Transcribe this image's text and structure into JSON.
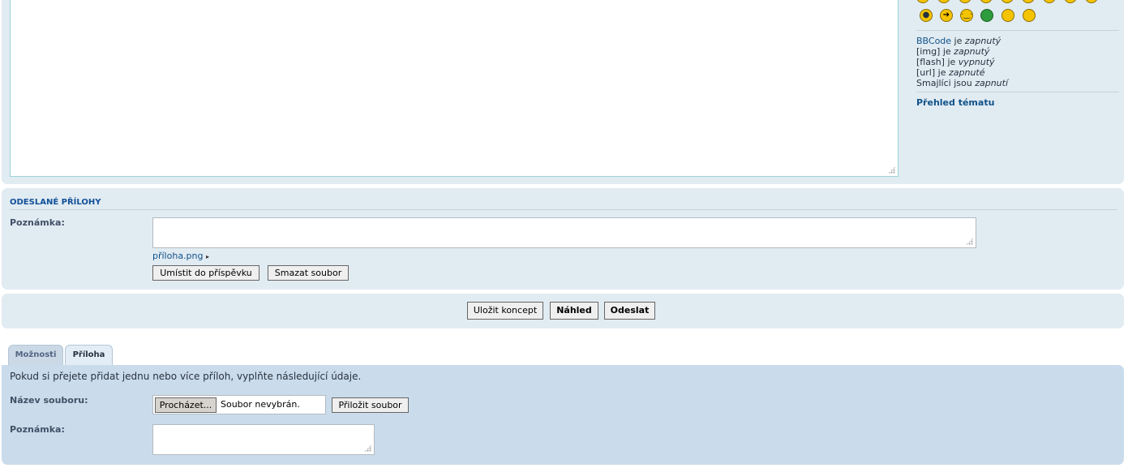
{
  "sidebar": {
    "status": [
      {
        "prefix_link": "BBCode",
        "mid": " je ",
        "state": "zapnutý"
      },
      {
        "prefix": "[img]",
        "mid": " je ",
        "state": "zapnutý"
      },
      {
        "prefix": "[flash]",
        "mid": " je ",
        "state": "vypnutý"
      },
      {
        "prefix": "[url]",
        "mid": " je ",
        "state": "zapnuté"
      },
      {
        "prefix": "Smajlíci",
        "mid": " jsou ",
        "state": "zapnutí"
      }
    ],
    "topic_review": "Přehled tématu",
    "smileys": [
      "lightbulb-icon",
      "arrow-icon",
      "neutral-face-icon",
      "green-face-icon",
      "glasses-face-icon",
      "geek-face-icon"
    ]
  },
  "attachments": {
    "title": "Odeslané přílohy",
    "comment_label": "Poznámka:",
    "file_name": "příloha.png",
    "place_inline": "Umístit do příspěvku",
    "delete_file": "Smazat soubor"
  },
  "submit": {
    "save_draft": "Uložit koncept",
    "preview": "Náhled",
    "send": "Odeslat"
  },
  "tabs": {
    "options": "Možnosti",
    "attachment": "Příloha"
  },
  "upload": {
    "intro": "Pokud si přejete přidat jednu nebo více příloh, vyplňte následující údaje.",
    "filename_label": "Název souboru:",
    "browse": "Procházet...",
    "no_file": "Soubor nevybrán.",
    "attach_button": "Přiložit soubor",
    "comment_label": "Poznámka:"
  },
  "colors": {
    "panel_bg": "#e1ebf2",
    "upload_bg": "#cadceb",
    "link": "#105289"
  }
}
